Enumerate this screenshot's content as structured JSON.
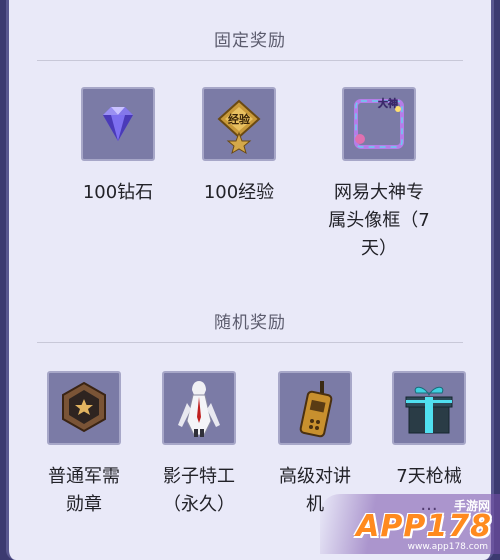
{
  "fixed_rewards": {
    "title": "固定奖励",
    "items": [
      {
        "label": "100钻石",
        "icon": "diamond-icon"
      },
      {
        "label": "100经验",
        "icon": "experience-badge-icon"
      },
      {
        "label": "网易大神专属头像框（7天）",
        "icon": "avatar-frame-icon"
      }
    ]
  },
  "random_rewards": {
    "title": "随机奖励",
    "items": [
      {
        "label": "普通军需勋章",
        "icon": "medal-icon"
      },
      {
        "label": "影子特工（永久）",
        "icon": "shadow-agent-icon"
      },
      {
        "label": "高级对讲机",
        "icon": "walkie-talkie-icon"
      },
      {
        "label": "7天枪械...",
        "icon": "gift-box-icon"
      }
    ]
  },
  "avatar_frame_text": "大神",
  "experience_text": "经验",
  "watermark": {
    "text": "APP178",
    "sub": "手游网",
    "url": "www.app178.com"
  }
}
